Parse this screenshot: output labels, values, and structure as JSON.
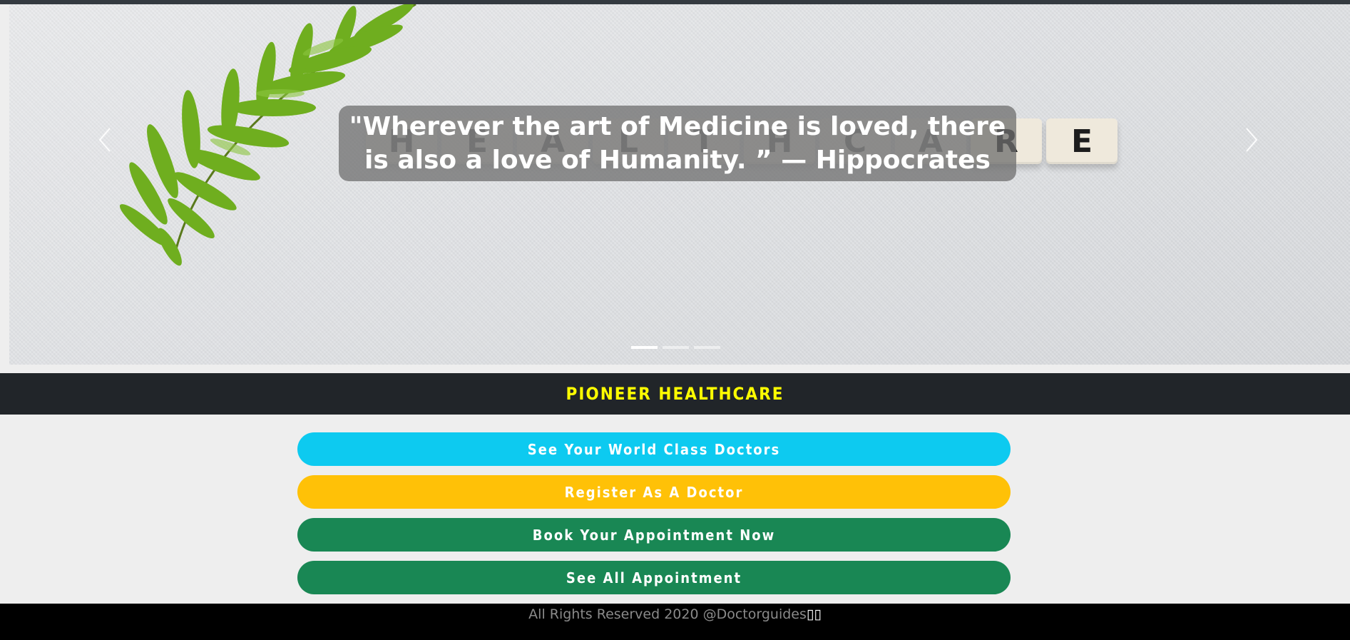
{
  "carousel": {
    "caption": "\"Wherever the art of Medicine is loved, there is also a love of Humanity. ” — Hippocrates",
    "tiles": [
      "R",
      "E"
    ],
    "faded_tiles": [
      "H",
      "E",
      "A",
      "L",
      "T",
      "H",
      "C",
      "A"
    ],
    "indicators": 3,
    "active_indicator": 0,
    "prev_icon": "chevron-left-icon",
    "next_icon": "chevron-right-icon"
  },
  "brand": {
    "name": "PIONEER HEALTHCARE",
    "color": "#ffff00"
  },
  "actions": [
    {
      "label": "See Your World Class Doctors",
      "color": "#0dcaf0"
    },
    {
      "label": "Register As A Doctor",
      "color": "#ffc107"
    },
    {
      "label": "Book Your Appointment Now",
      "color": "#198754"
    },
    {
      "label": "See All Appointment",
      "color": "#198754"
    }
  ],
  "footer": {
    "text": "All Rights Reserved 2020 @Doctorguides",
    "glyphs": "▯▯"
  }
}
